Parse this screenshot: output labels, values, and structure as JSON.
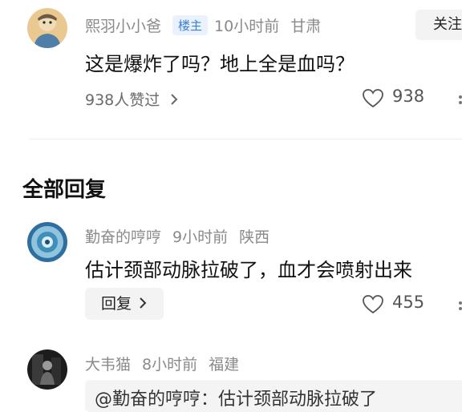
{
  "comment": {
    "username": "熙羽小小爸",
    "badge": "楼主",
    "time": "10小时前",
    "location": "甘肃",
    "follow_label": "关注",
    "text": "这是爆炸了吗？地上全是血吗？",
    "liked_by": "938人赞过",
    "like_count": "938"
  },
  "section_title": "全部回复",
  "replies": [
    {
      "username": "勤奋的哼哼",
      "time": "9小时前",
      "location": "陕西",
      "text": "估计颈部动脉拉破了，血才会喷射出来",
      "reply_label": "回复",
      "like_count": "455"
    },
    {
      "username": "大韦猫",
      "time": "8小时前",
      "location": "福建",
      "quote_text": "@勤奋的哼哼：估计颈部动脉拉破了"
    }
  ],
  "icons": [
    "heart-icon",
    "chevron-right-icon",
    "more-icon"
  ],
  "colors": {
    "accent_badge": "#3b7fd6",
    "meta_gray": "#8a8a8a"
  }
}
